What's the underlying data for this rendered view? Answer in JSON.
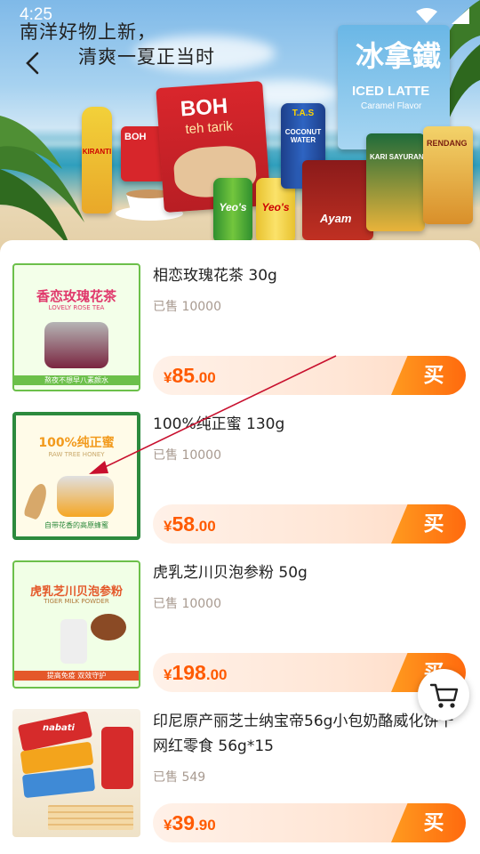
{
  "status_bar": {
    "time": "4:25"
  },
  "banner": {
    "slogan_line1": "南洋好物上新，",
    "slogan_line2": "清爽一夏正当时",
    "pack_boh_brand": "BOH",
    "pack_boh_sub": "teh tarik",
    "pack_kiranti": "KIRANTI",
    "pack_boh_small": "BOH",
    "pack_tas": "T.A.S",
    "pack_coconut": "COCONUT WATER",
    "pack_latte_cn": "冰拿鐵",
    "pack_latte_en": "ICED LATTE",
    "pack_latte_flavor": "Caramel Flavor",
    "pack_yeos_1": "Yeo's",
    "pack_yeos_2": "Yeo's",
    "pack_kari": "KARI SAYURAN",
    "pack_rendang": "RENDANG",
    "pack_ayam": "Ayam"
  },
  "products": [
    {
      "name": "相恋玫瑰花茶 30g",
      "sold": "已售 10000",
      "price_symbol": "¥",
      "price_int": "85",
      "price_dec": ".00",
      "buy": "买",
      "thumb_title": "香恋玫瑰花茶",
      "thumb_sub": "LOVELY ROSE TEA",
      "thumb_footer": "熬夜不想早八素颜水"
    },
    {
      "name": "100%纯正蜜 130g",
      "sold": "已售 10000",
      "price_symbol": "¥",
      "price_int": "58",
      "price_dec": ".00",
      "buy": "买",
      "thumb_title": "100%纯正蜜",
      "thumb_sub": "RAW TREE HONEY",
      "thumb_footer": "自带花香的高原蜂蜜"
    },
    {
      "name": "虎乳芝川贝泡参粉 50g",
      "sold": "已售 10000",
      "price_symbol": "¥",
      "price_int": "198",
      "price_dec": ".00",
      "buy": "买",
      "thumb_title": "虎乳芝川贝泡参粉",
      "thumb_sub": "TIGER MILK POWDER",
      "thumb_footer": "提高免疫 双效守护"
    },
    {
      "name": "印尼原产丽芝士纳宝帝56g小包奶酪威化饼干网红零食 56g*15",
      "sold": "已售 549",
      "price_symbol": "¥",
      "price_int": "39",
      "price_dec": ".90",
      "buy": "买",
      "thumb_brand": "nabati"
    }
  ],
  "colors": {
    "accent": "#ff5a00",
    "buy_gradient_start": "#ff9a1f",
    "buy_gradient_end": "#ff6a0e",
    "annotation_arrow": "#c8102e"
  },
  "icons": {
    "back": "chevron-left-icon",
    "cart": "cart-icon",
    "wifi": "wifi-icon",
    "signal": "signal-icon"
  }
}
